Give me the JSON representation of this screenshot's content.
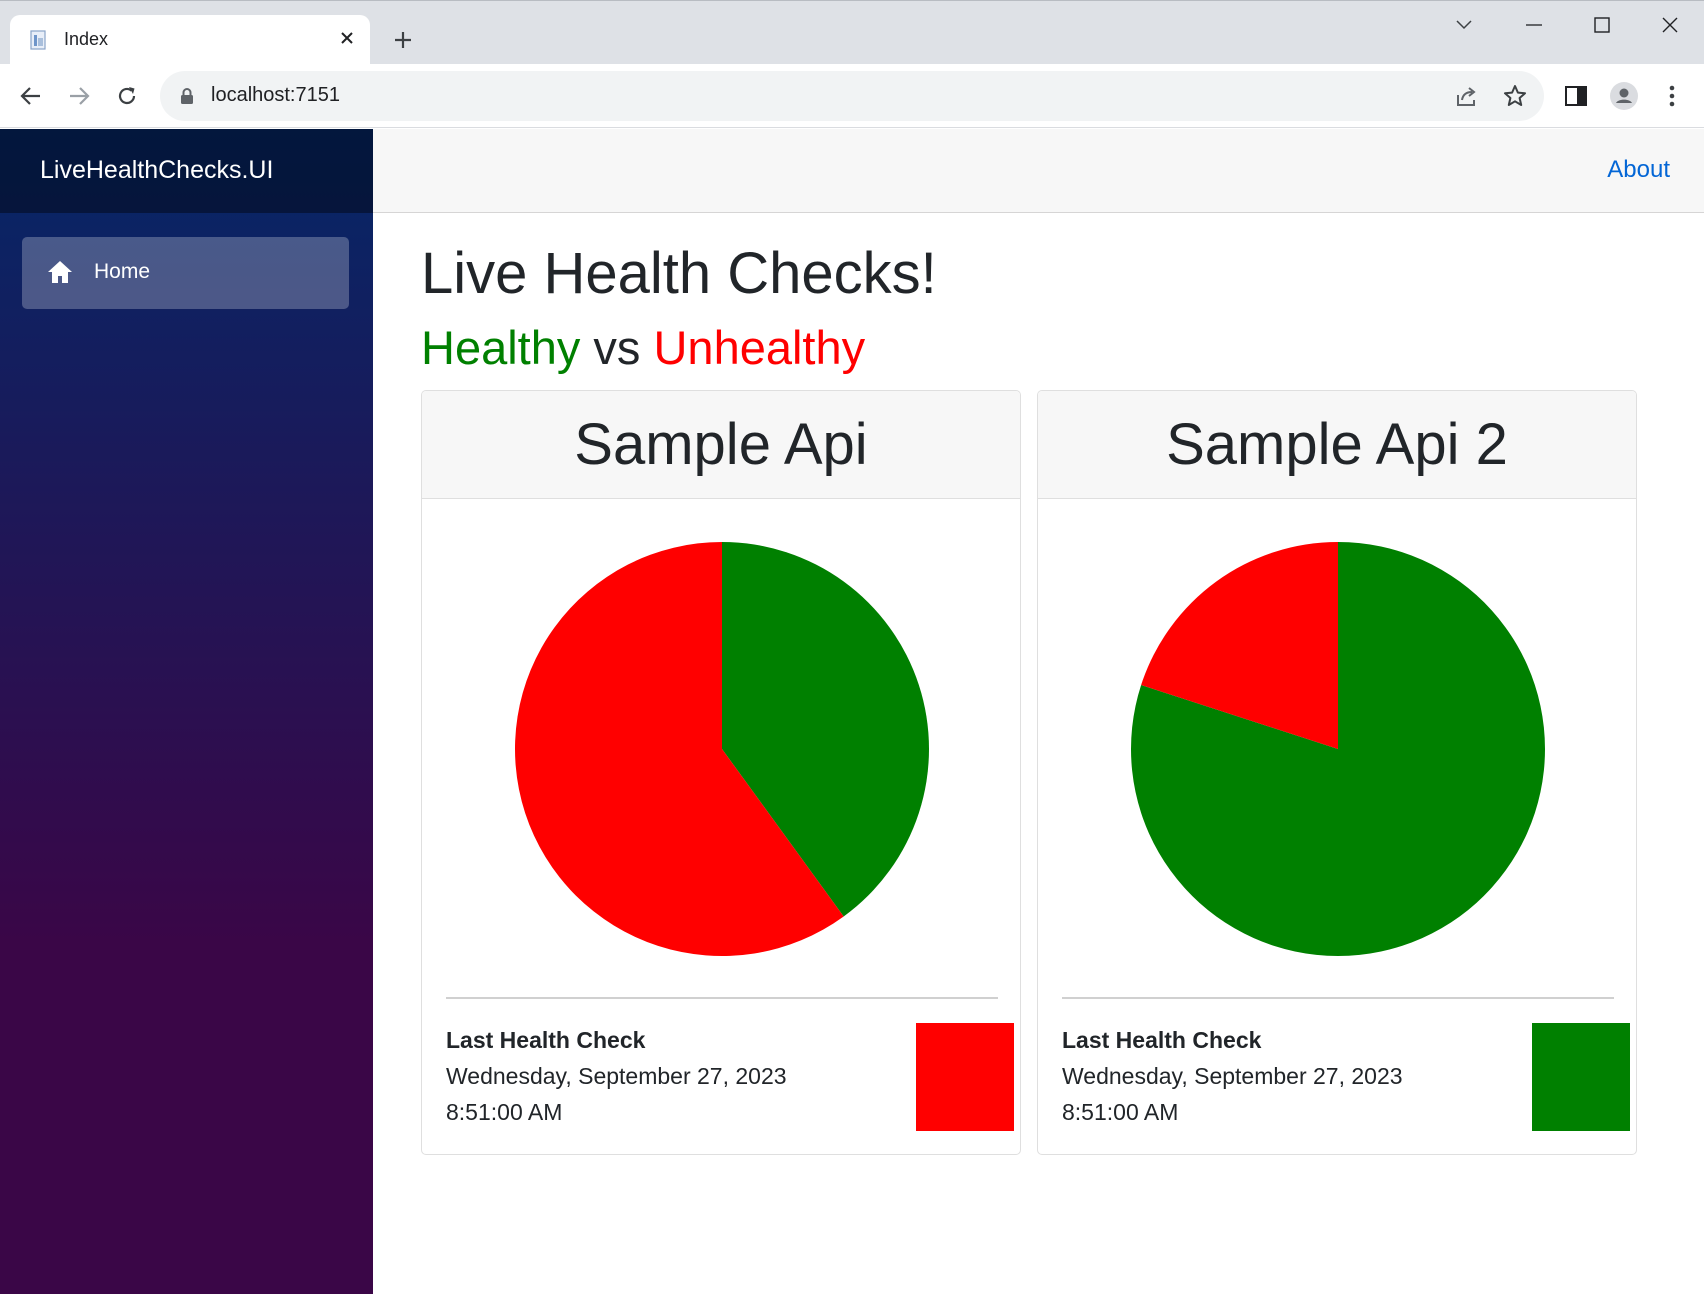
{
  "browser": {
    "tab_title": "Index",
    "url": "localhost:7151"
  },
  "app": {
    "brand": "LiveHealthChecks.UI",
    "nav_home": "Home",
    "about": "About"
  },
  "page": {
    "title": "Live Health Checks!",
    "subtitle_healthy": "Healthy",
    "subtitle_vs": " vs ",
    "subtitle_unhealthy": "Unhealthy"
  },
  "colors": {
    "healthy": "#008000",
    "unhealthy": "#ff0000",
    "sidebar_top": "#052767",
    "sidebar_bottom": "#3a0647",
    "link": "#0366d6"
  },
  "cards": [
    {
      "name": "Sample Api",
      "last_check_label": "Last Health Check",
      "last_check_date": "Wednesday, September 27, 2023",
      "last_check_time": "8:51:00 AM",
      "status_color": "#ff0000"
    },
    {
      "name": "Sample Api 2",
      "last_check_label": "Last Health Check",
      "last_check_date": "Wednesday, September 27, 2023",
      "last_check_time": "8:51:00 AM",
      "status_color": "#008000"
    }
  ],
  "chart_data": [
    {
      "type": "pie",
      "categories": [
        "Healthy",
        "Unhealthy"
      ],
      "values": [
        40,
        60
      ],
      "colors": [
        "#008000",
        "#ff0000"
      ]
    },
    {
      "type": "pie",
      "categories": [
        "Healthy",
        "Unhealthy"
      ],
      "values": [
        80,
        20
      ],
      "colors": [
        "#008000",
        "#ff0000"
      ]
    }
  ]
}
